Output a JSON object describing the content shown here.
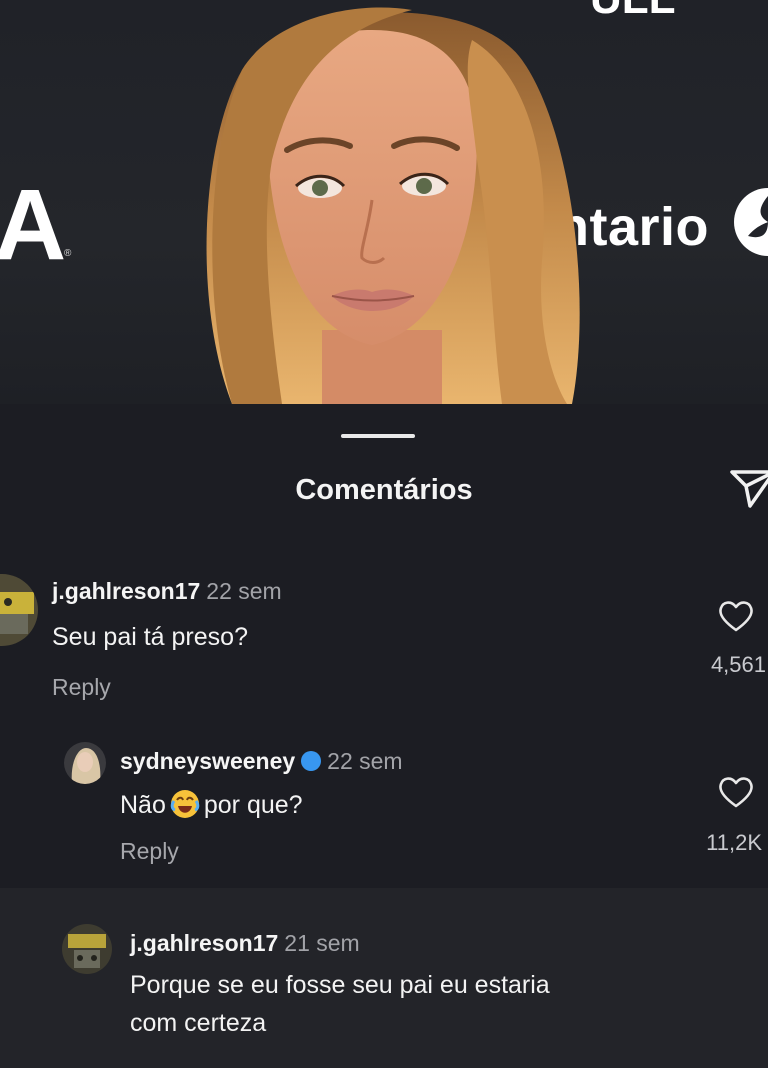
{
  "backdrop": {
    "left_letter": "A",
    "left_reg_mark": "®",
    "right_word": "ntario",
    "top_fragment": "ULL"
  },
  "sheet": {
    "title": "Comentários"
  },
  "comments": [
    {
      "username": "j.gahlreson17",
      "time": "22 sem",
      "text": "Seu pai tá preso?",
      "reply_label": "Reply",
      "likes": "4,561"
    },
    {
      "username": "sydneysweeney",
      "verified": true,
      "time": "22 sem",
      "text_before_emoji": "Não",
      "emoji": "crying-laughing-face",
      "text_after_emoji": "por que?",
      "reply_label": "Reply",
      "likes": "11,2K"
    },
    {
      "username": "j.gahlreson17",
      "time": "21 sem",
      "text_line1": "Porque se eu fosse seu pai eu estaria",
      "text_line2": "com certeza"
    }
  ],
  "colors": {
    "sheet_bg": "#1c1d23",
    "verified_blue": "#3897f0",
    "muted_text": "#a2a3a8"
  }
}
